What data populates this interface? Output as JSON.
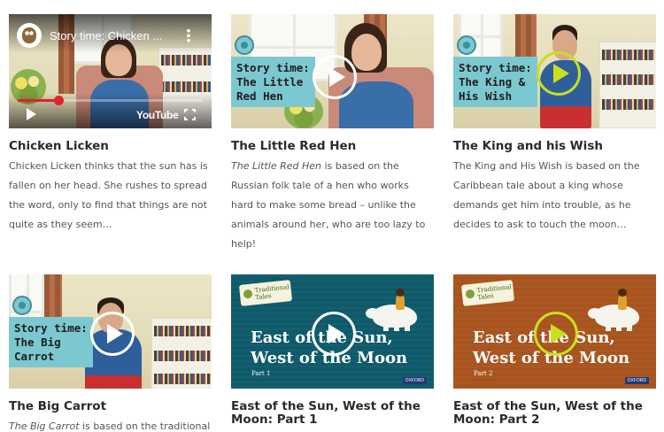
{
  "videos": [
    {
      "title": "Chicken Licken",
      "desc_lead": "",
      "desc": "Chicken Licken thinks that the sun has is fallen on her head. She rushes to spread the word, only to find that things are not quite as they seem…",
      "player": {
        "video_title": "Story time: Chicken ...",
        "logo": "YouTube",
        "progress": 0.22
      }
    },
    {
      "title": "The Little Red Hen",
      "desc_lead": "The Little Red Hen",
      "desc": " is based on the Russian folk tale of a hen who works hard to make some bread – unlike the animals around her, who are too lazy to help!",
      "badge": [
        "Story time:",
        "The Little",
        "Red Hen"
      ]
    },
    {
      "title": "The King and his Wish",
      "desc_lead": "",
      "desc": "The King and His Wish is based on the Caribbean tale about a king whose demands get him into trouble, as he decides to ask to touch the moon…",
      "badge": [
        "Story time:",
        "The King &",
        "His Wish"
      ]
    },
    {
      "title": "The Big Carrot",
      "desc_lead": "The Big Carrot",
      "desc": " is based on the traditional",
      "badge": [
        "Story time:",
        "The Big",
        "Carrot"
      ]
    },
    {
      "title": "East of the Sun, West of the Moon: Part 1",
      "tag": [
        "Traditional",
        "Tales"
      ],
      "art_title": [
        "East of the Sun,",
        "West of the Moon"
      ],
      "part": "Part 1",
      "publisher": "OXFORD"
    },
    {
      "title": "East of the Sun, West of the Moon: Part 2",
      "tag": [
        "Traditional",
        "Tales"
      ],
      "art_title": [
        "East of the Sun,",
        "West of the Moon"
      ],
      "part": "Part 2",
      "publisher": "OXFORD"
    }
  ],
  "colors": {
    "badge": "#7cc8d0",
    "play_lime": "#c8e020",
    "tales_teal": "#0e5a6a",
    "tales_brown": "#a8541e",
    "yt_red": "#e0222a"
  },
  "icons": {
    "play": "play-icon",
    "menu": "more-vert-icon",
    "fullscreen": "fullscreen-icon"
  }
}
